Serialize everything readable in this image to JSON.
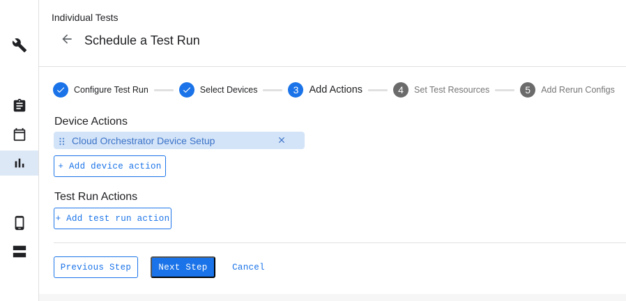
{
  "sidebar": {
    "items": [
      {
        "icon": "wrench-icon"
      },
      {
        "icon": "clipboard-icon"
      },
      {
        "icon": "calendar-icon"
      },
      {
        "icon": "bar-chart-icon",
        "active": true
      },
      {
        "icon": "phone-icon"
      },
      {
        "icon": "server-icon"
      }
    ]
  },
  "header": {
    "breadcrumb": "Individual Tests",
    "title": "Schedule a Test Run"
  },
  "stepper": {
    "steps": [
      {
        "number": "1",
        "label": "Configure Test Run",
        "state": "done"
      },
      {
        "number": "2",
        "label": "Select Devices",
        "state": "done"
      },
      {
        "number": "3",
        "label": "Add Actions",
        "state": "current"
      },
      {
        "number": "4",
        "label": "Set Test Resources",
        "state": "todo"
      },
      {
        "number": "5",
        "label": "Add Rerun Configs",
        "state": "todo"
      }
    ]
  },
  "device_actions": {
    "title": "Device Actions",
    "items": [
      {
        "label": "Cloud Orchestrator Device Setup"
      }
    ],
    "add_label": "+ Add device action"
  },
  "test_run_actions": {
    "title": "Test Run Actions",
    "add_label": "+ Add test run action"
  },
  "footer": {
    "previous_label": "Previous Step",
    "next_label": "Next Step",
    "cancel_label": "Cancel"
  },
  "colors": {
    "accent": "#1a73e8",
    "chip_bg": "#d4e4f8",
    "active_nav": "#dde8f6"
  }
}
